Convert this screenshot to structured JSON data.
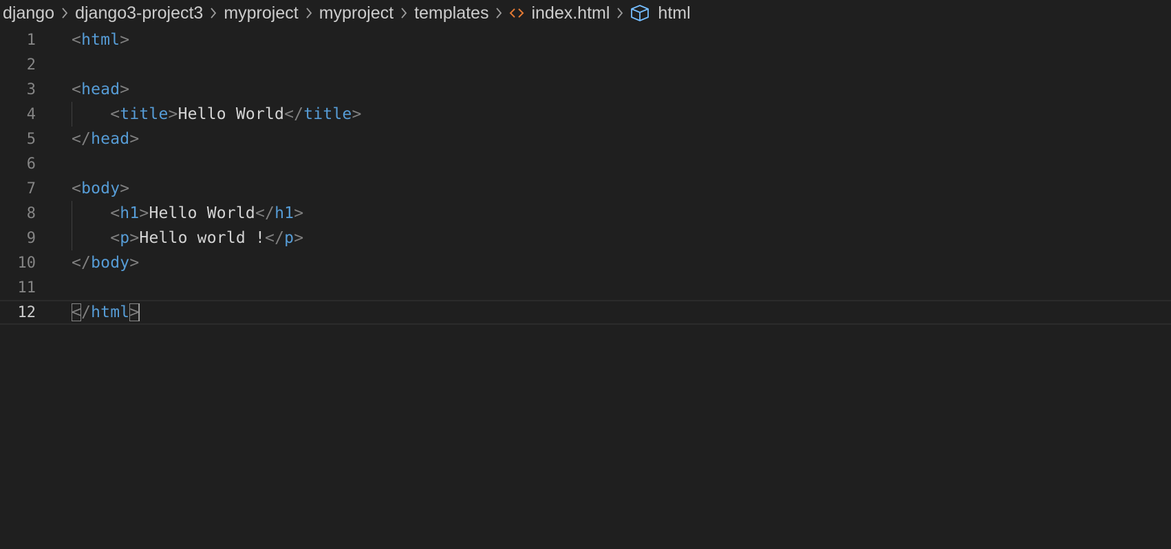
{
  "breadcrumb": {
    "segments": [
      "django",
      "django3-project3",
      "myproject",
      "myproject",
      "templates"
    ],
    "file": "index.html",
    "symbol": "html"
  },
  "colors": {
    "background": "#1f1f1f",
    "tag": "#569cd6",
    "punctuation": "#808080",
    "text": "#d4d4d4",
    "file_icon": "#e37933",
    "symbol_icon": "#75beff"
  },
  "editor": {
    "current_line": "12",
    "lines": [
      {
        "number": "1",
        "lt": "<",
        "tag": "html",
        "gt": ">"
      },
      {
        "number": "2"
      },
      {
        "number": "3",
        "lt": "<",
        "tag": "head",
        "gt": ">"
      },
      {
        "number": "4",
        "indent": "    ",
        "lt": "<",
        "tag": "title",
        "gt": ">",
        "text": "Hello World",
        "close_lt": "</",
        "close_tag": "title",
        "close_gt": ">"
      },
      {
        "number": "5",
        "lt": "</",
        "tag": "head",
        "gt": ">"
      },
      {
        "number": "6"
      },
      {
        "number": "7",
        "lt": "<",
        "tag": "body",
        "gt": ">"
      },
      {
        "number": "8",
        "indent": "    ",
        "lt": "<",
        "tag": "h1",
        "gt": ">",
        "text": "Hello World",
        "close_lt": "</",
        "close_tag": "h1",
        "close_gt": ">"
      },
      {
        "number": "9",
        "indent": "    ",
        "lt": "<",
        "tag": "p",
        "gt": ">",
        "text": "Hello world !",
        "close_lt": "</",
        "close_tag": "p",
        "close_gt": ">"
      },
      {
        "number": "10",
        "lt": "</",
        "tag": "body",
        "gt": ">"
      },
      {
        "number": "11"
      },
      {
        "number": "12",
        "lt_a": "<",
        "lt_b": "/",
        "tag": "html",
        "gt": ">"
      }
    ]
  }
}
